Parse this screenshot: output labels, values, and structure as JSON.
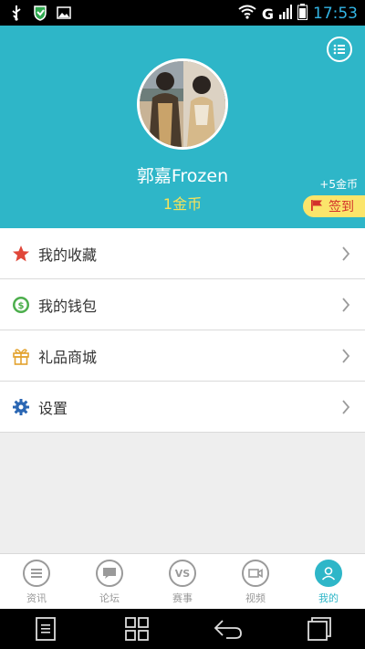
{
  "status_bar": {
    "network": "G",
    "time": "17:53",
    "time_color": "#33b5e5"
  },
  "header": {
    "bg_color": "#2eb6c8",
    "username": "郭嘉Frozen",
    "coins": "1金币",
    "bonus": "+5金币",
    "signin_label": "签到"
  },
  "menu": {
    "items": [
      {
        "label": "我的收藏",
        "icon": "star-icon"
      },
      {
        "label": "我的钱包",
        "icon": "wallet-icon"
      },
      {
        "label": "礼品商城",
        "icon": "gift-icon"
      },
      {
        "label": "设置",
        "icon": "gear-icon"
      }
    ]
  },
  "tabs": [
    {
      "label": "资讯",
      "icon": "news-icon",
      "active": false
    },
    {
      "label": "论坛",
      "icon": "forum-icon",
      "active": false
    },
    {
      "label": "赛事",
      "icon": "vs-icon",
      "icon_text": "VS",
      "active": false
    },
    {
      "label": "视频",
      "icon": "video-icon",
      "active": false
    },
    {
      "label": "我的",
      "icon": "profile-icon",
      "active": true
    }
  ]
}
